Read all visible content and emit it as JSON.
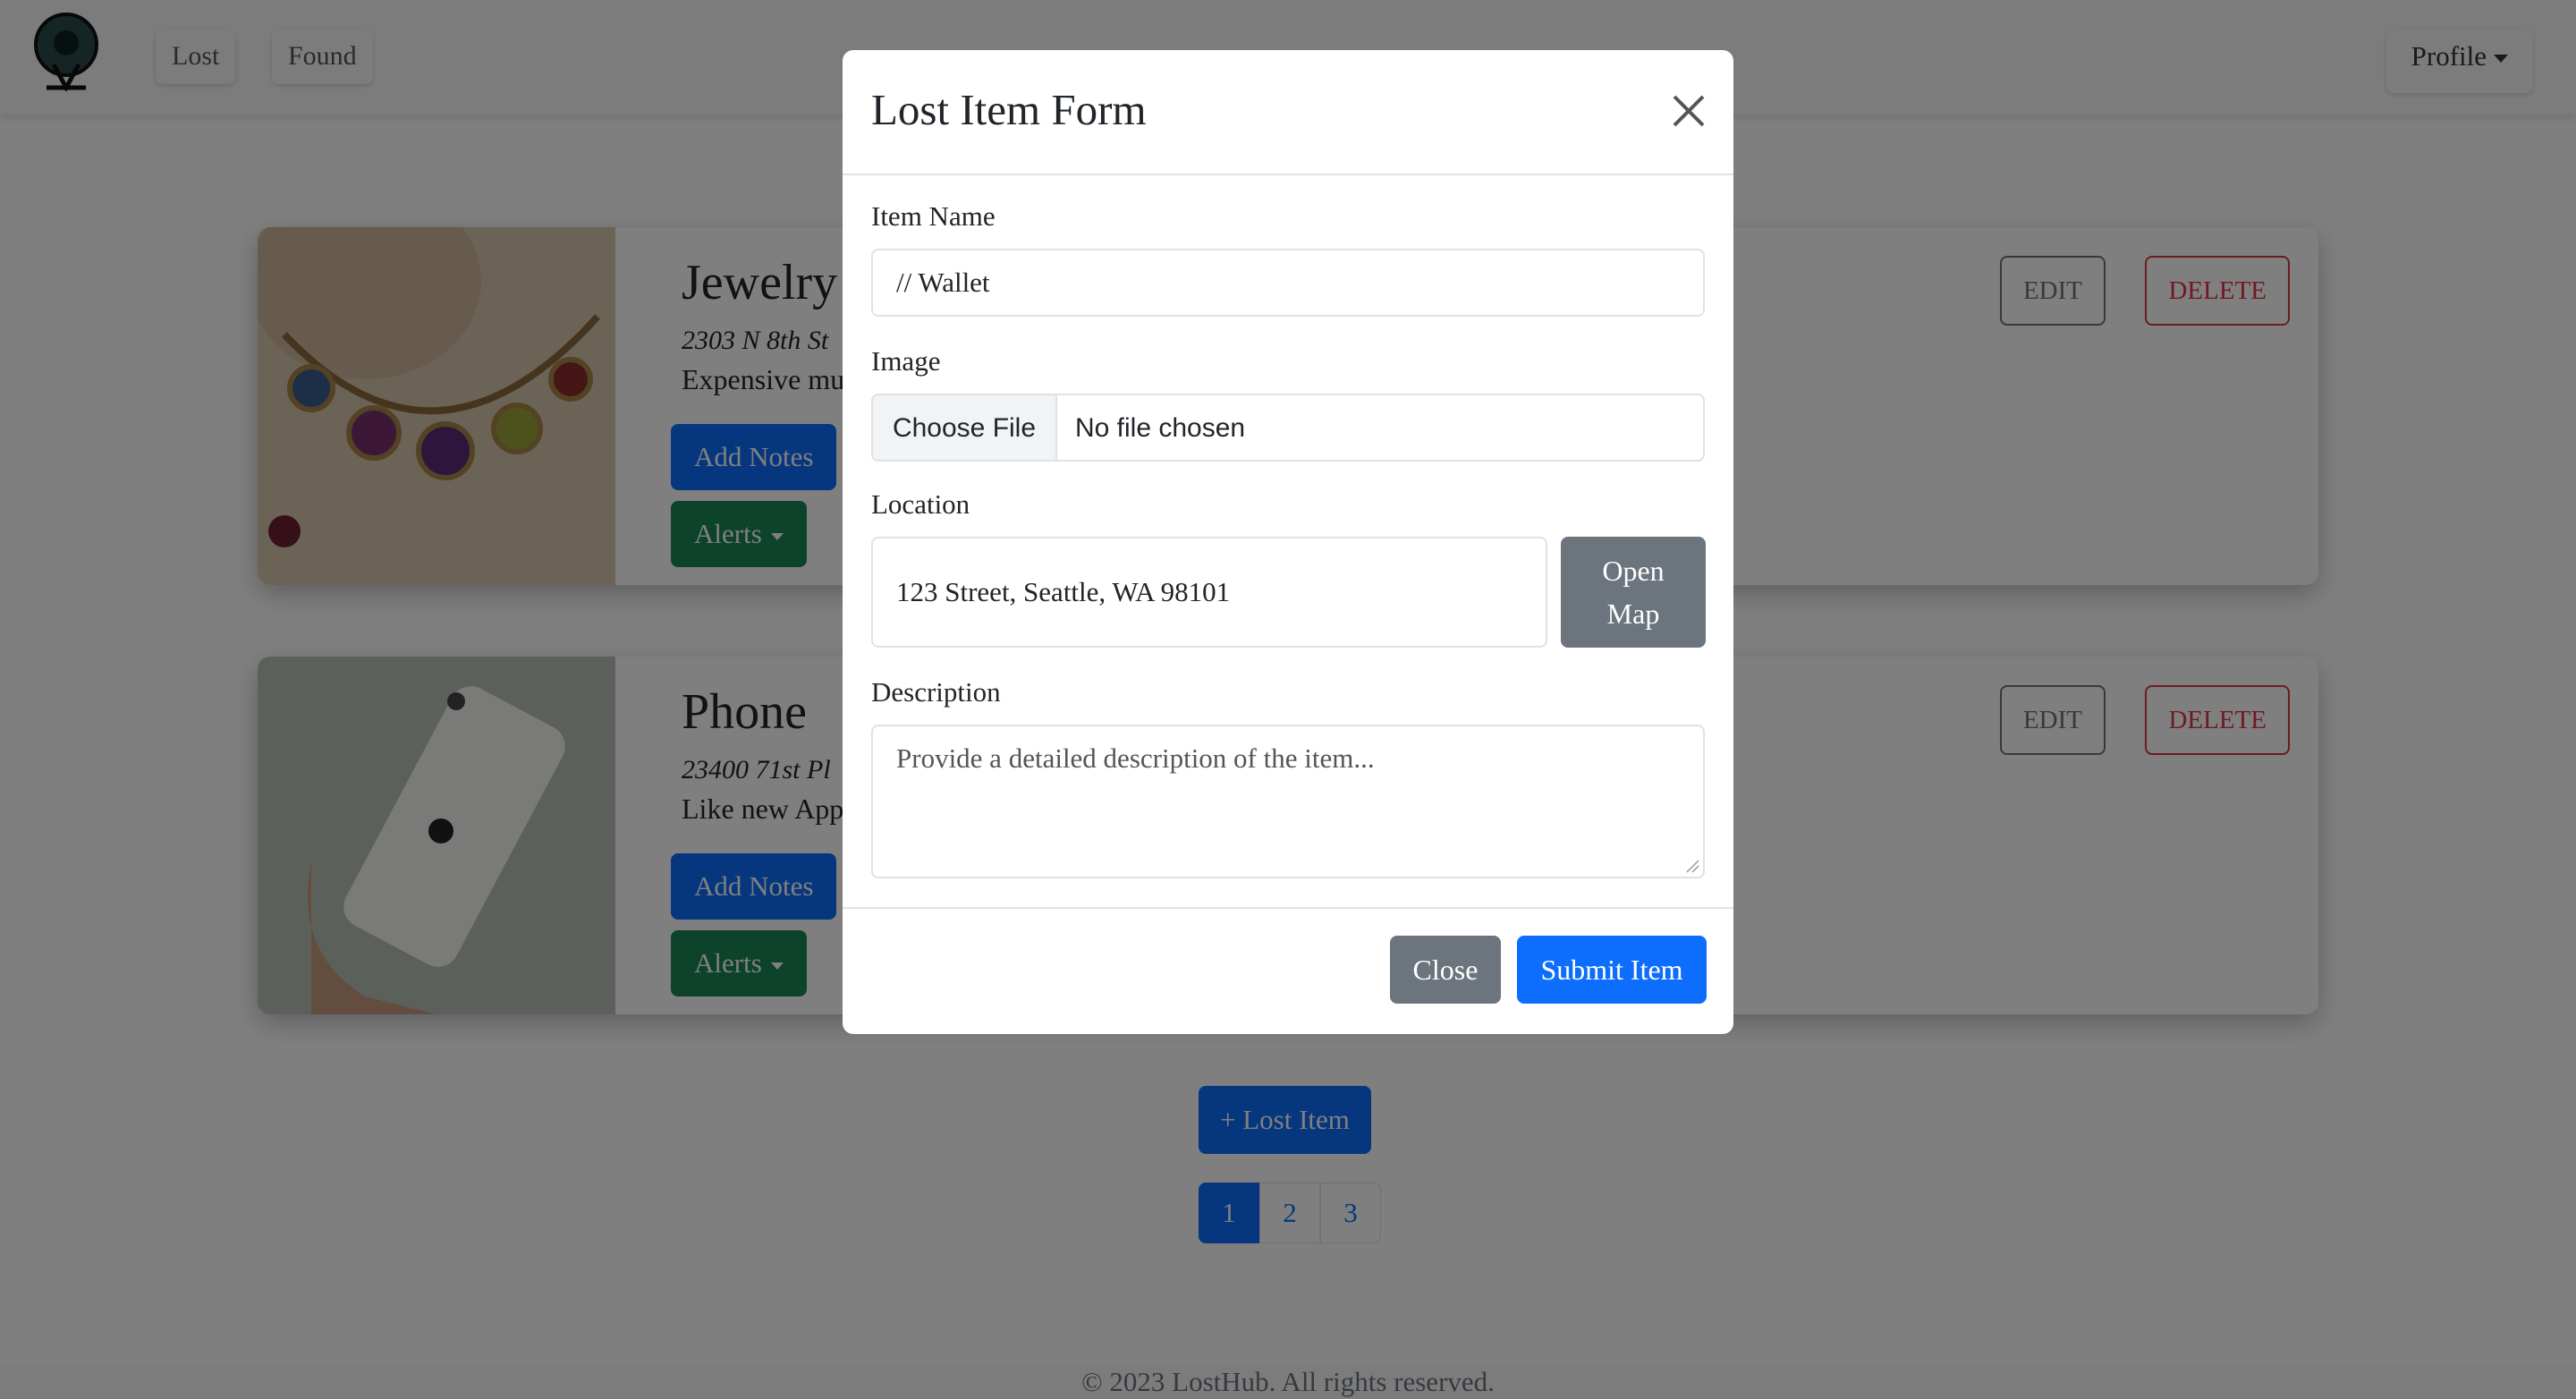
{
  "nav": {
    "lost": "Lost",
    "found": "Found",
    "profile": "Profile"
  },
  "cards": [
    {
      "title": "Jewelry",
      "address": "2303 N 8th St",
      "description": "Expensive mu",
      "notes": "Add Notes",
      "alerts": "Alerts",
      "edit": "EDIT",
      "delete": "DELETE"
    },
    {
      "title": "Phone",
      "address": "23400 71st Pl",
      "description": "Like new App",
      "notes": "Add Notes",
      "alerts": "Alerts",
      "edit": "EDIT",
      "delete": "DELETE"
    }
  ],
  "add_lost": "+ Lost Item",
  "pages": [
    "1",
    "2",
    "3"
  ],
  "footer": "© 2023 LostHub. All rights reserved.",
  "modal": {
    "title": "Lost Item Form",
    "item_name_label": "Item Name",
    "item_name_placeholder": "// Wallet",
    "image_label": "Image",
    "choose_file": "Choose File",
    "no_file": "No file chosen",
    "location_label": "Location",
    "location_placeholder": "123 Street, Seattle, WA 98101",
    "open_map_line1": "Open",
    "open_map_line2": "Map",
    "description_label": "Description",
    "description_placeholder": "Provide a detailed description of the item...",
    "close": "Close",
    "submit": "Submit Item"
  },
  "colors": {
    "primary": "#0d6efd",
    "secondary": "#6c757d",
    "success": "#198754",
    "danger": "#dc3545"
  }
}
